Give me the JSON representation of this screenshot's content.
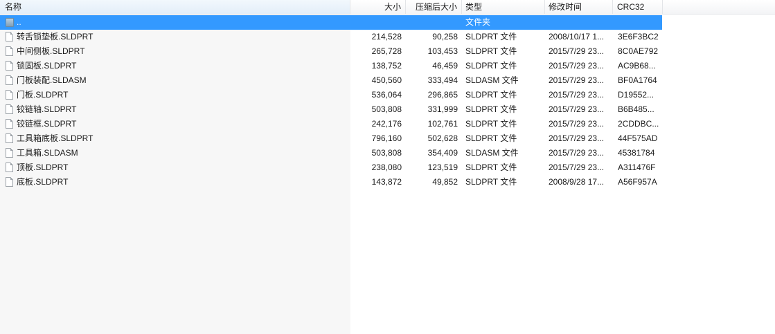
{
  "columns": {
    "name": "名称",
    "size": "大小",
    "packed": "压缩后大小",
    "type": "类型",
    "modified": "修改时间",
    "crc": "CRC32"
  },
  "parent_row": {
    "name": "..",
    "type": "文件夹"
  },
  "files": [
    {
      "name": "转舌锁垫板.SLDPRT",
      "size": "214,528",
      "packed": "90,258",
      "type": "SLDPRT 文件",
      "modified": "2008/10/17 1...",
      "crc": "3E6F3BC2"
    },
    {
      "name": "中间侧板.SLDPRT",
      "size": "265,728",
      "packed": "103,453",
      "type": "SLDPRT 文件",
      "modified": "2015/7/29 23...",
      "crc": "8C0AE792"
    },
    {
      "name": "锁固板.SLDPRT",
      "size": "138,752",
      "packed": "46,459",
      "type": "SLDPRT 文件",
      "modified": "2015/7/29 23...",
      "crc": "AC9B68..."
    },
    {
      "name": "门板装配.SLDASM",
      "size": "450,560",
      "packed": "333,494",
      "type": "SLDASM 文件",
      "modified": "2015/7/29 23...",
      "crc": "BF0A1764"
    },
    {
      "name": "门板.SLDPRT",
      "size": "536,064",
      "packed": "296,865",
      "type": "SLDPRT 文件",
      "modified": "2015/7/29 23...",
      "crc": "D19552..."
    },
    {
      "name": "铰链轴.SLDPRT",
      "size": "503,808",
      "packed": "331,999",
      "type": "SLDPRT 文件",
      "modified": "2015/7/29 23...",
      "crc": "B6B485..."
    },
    {
      "name": "铰链框.SLDPRT",
      "size": "242,176",
      "packed": "102,761",
      "type": "SLDPRT 文件",
      "modified": "2015/7/29 23...",
      "crc": "2CDDBC..."
    },
    {
      "name": "工具箱底板.SLDPRT",
      "size": "796,160",
      "packed": "502,628",
      "type": "SLDPRT 文件",
      "modified": "2015/7/29 23...",
      "crc": "44F575AD"
    },
    {
      "name": "工具箱.SLDASM",
      "size": "503,808",
      "packed": "354,409",
      "type": "SLDASM 文件",
      "modified": "2015/7/29 23...",
      "crc": "45381784"
    },
    {
      "name": "顶板.SLDPRT",
      "size": "238,080",
      "packed": "123,519",
      "type": "SLDPRT 文件",
      "modified": "2015/7/29 23...",
      "crc": "A311476F"
    },
    {
      "name": "底板.SLDPRT",
      "size": "143,872",
      "packed": "49,852",
      "type": "SLDPRT 文件",
      "modified": "2008/9/28 17...",
      "crc": "A56F957A"
    }
  ]
}
